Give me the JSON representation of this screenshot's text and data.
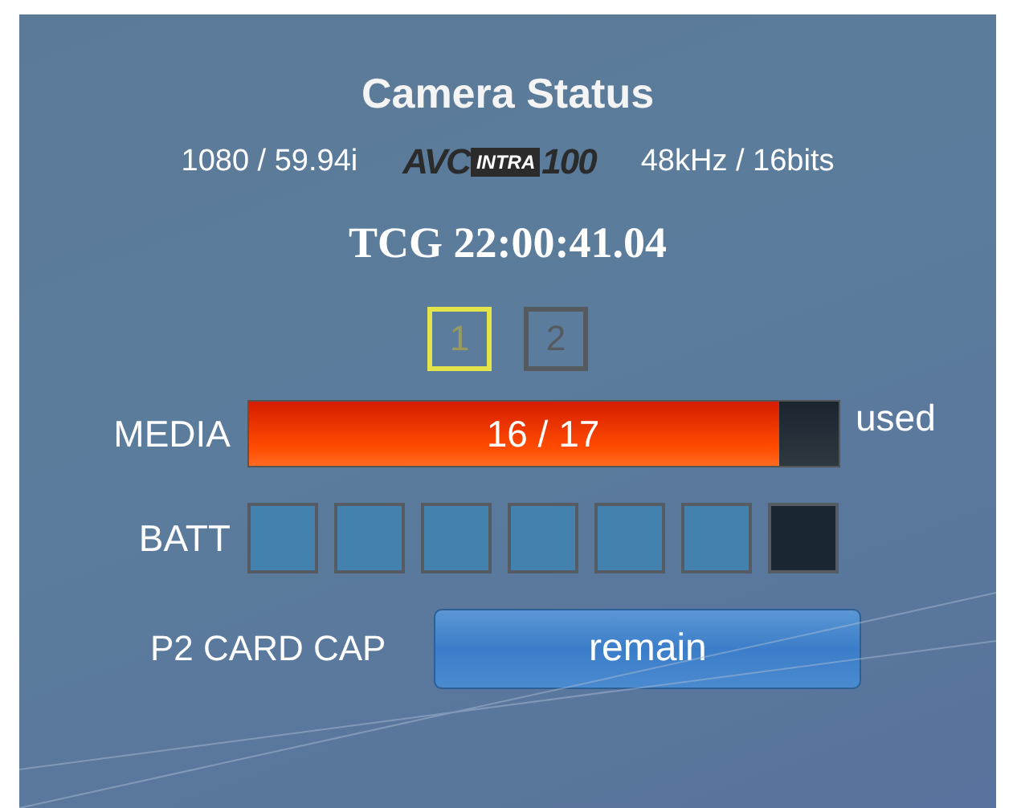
{
  "title": "Camera Status",
  "format": "1080 / 59.94i",
  "codec_logo": {
    "prefix": "AVC",
    "badge": "INTRA",
    "suffix": "100"
  },
  "audio": "48kHz / 16bits",
  "timecode": "TCG 22:00:41.04",
  "card_slots": [
    {
      "label": "1",
      "selected": true
    },
    {
      "label": "2",
      "selected": false
    }
  ],
  "media": {
    "label": "MEDIA",
    "reading": "16 / 17",
    "level": 0.9,
    "unit": "used"
  },
  "battery": {
    "label": "BATT",
    "segments": [
      {
        "on": true
      },
      {
        "on": true
      },
      {
        "on": true
      },
      {
        "on": true
      },
      {
        "on": true
      },
      {
        "on": true
      },
      {
        "on": false
      }
    ]
  },
  "card_cap": {
    "label": "P2 CARD CAP",
    "button": "remain"
  }
}
